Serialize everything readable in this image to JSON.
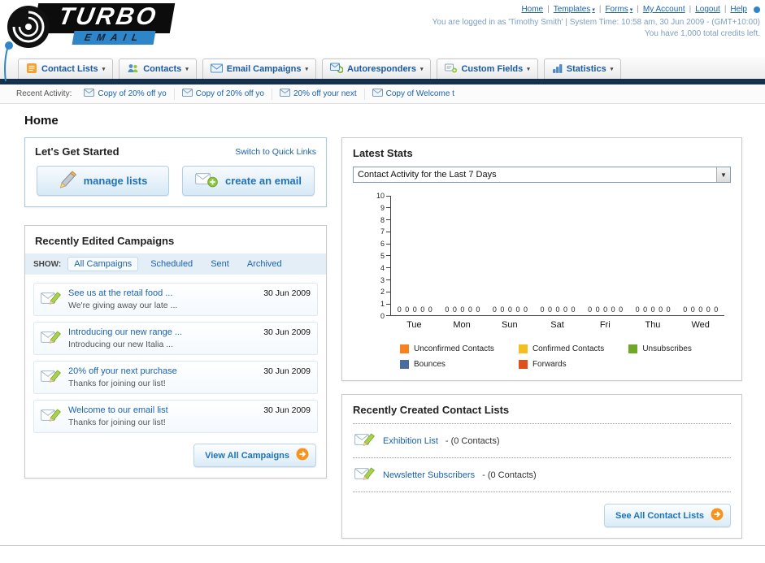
{
  "header": {
    "logo_text": "TURBO",
    "logo_sub": "EMAIL",
    "nav_links": [
      "Home",
      "Templates",
      "Forms",
      "My Account",
      "Logout",
      "Help"
    ],
    "login_info": "You are logged in as 'Timothy Smith' | System Time: 10:58 am, 30 Jun 2009 - (GMT+10:00)",
    "credits_info": "You have 1,000 total credits left."
  },
  "main_nav": {
    "items": [
      {
        "label": "Contact Lists"
      },
      {
        "label": "Contacts"
      },
      {
        "label": "Email Campaigns"
      },
      {
        "label": "Autoresponders"
      },
      {
        "label": "Custom Fields"
      },
      {
        "label": "Statistics"
      }
    ]
  },
  "recent_activity": {
    "label": "Recent Activity:",
    "items": [
      "Copy of 20% off yo",
      "Copy of 20% off yo",
      "20% off your next",
      "Copy of Welcome t"
    ]
  },
  "page": {
    "title": "Home"
  },
  "get_started": {
    "title": "Let's Get Started",
    "switch_link": "Switch to Quick Links",
    "manage_lists_label": "manage lists",
    "create_email_label": "create an email"
  },
  "campaigns": {
    "title": "Recently Edited Campaigns",
    "show_label": "SHOW:",
    "tabs": [
      "All Campaigns",
      "Scheduled",
      "Sent",
      "Archived"
    ],
    "active_tab": "All Campaigns",
    "items": [
      {
        "title": "See us at the retail food ...",
        "subtitle": "We're giving away our late ...",
        "date": "30 Jun 2009"
      },
      {
        "title": "Introducing our new range ...",
        "subtitle": "Introducing our new Italia ...",
        "date": "30 Jun 2009"
      },
      {
        "title": "20% off your next purchase",
        "subtitle": "Thanks for joining our list!",
        "date": "30 Jun 2009"
      },
      {
        "title": "Welcome to our email list",
        "subtitle": "Thanks for joining our list!",
        "date": "30 Jun 2009"
      }
    ],
    "view_all_label": "View All Campaigns"
  },
  "latest_stats": {
    "title": "Latest Stats",
    "dropdown_value": "Contact Activity for the Last 7 Days",
    "chart_data": {
      "type": "bar",
      "title": "Contact Activity for the Last 7 Days",
      "categories": [
        "Tue",
        "Mon",
        "Sun",
        "Sat",
        "Fri",
        "Thu",
        "Wed"
      ],
      "series": [
        {
          "name": "Unconfirmed Contacts",
          "color": "#f5821f",
          "values": [
            0,
            0,
            0,
            0,
            0,
            0,
            0
          ]
        },
        {
          "name": "Confirmed Contacts",
          "color": "#f2c01e",
          "values": [
            0,
            0,
            0,
            0,
            0,
            0,
            0
          ]
        },
        {
          "name": "Unsubscribes",
          "color": "#6fa726",
          "values": [
            0,
            0,
            0,
            0,
            0,
            0,
            0
          ]
        },
        {
          "name": "Bounces",
          "color": "#4a6d9d",
          "values": [
            0,
            0,
            0,
            0,
            0,
            0,
            0
          ]
        },
        {
          "name": "Forwards",
          "color": "#e0501e",
          "values": [
            0,
            0,
            0,
            0,
            0,
            0,
            0
          ]
        }
      ],
      "ylim": [
        0,
        10
      ],
      "ytick_step": 1,
      "grid": false,
      "legend_position": "bottom"
    }
  },
  "contact_lists": {
    "title": "Recently Created Contact Lists",
    "items": [
      {
        "name": "Exhibition List",
        "detail": "- (0 Contacts)"
      },
      {
        "name": "Newsletter Subscribers",
        "detail": "- (0 Contacts)"
      }
    ],
    "see_all_label": "See All Contact Lists"
  }
}
